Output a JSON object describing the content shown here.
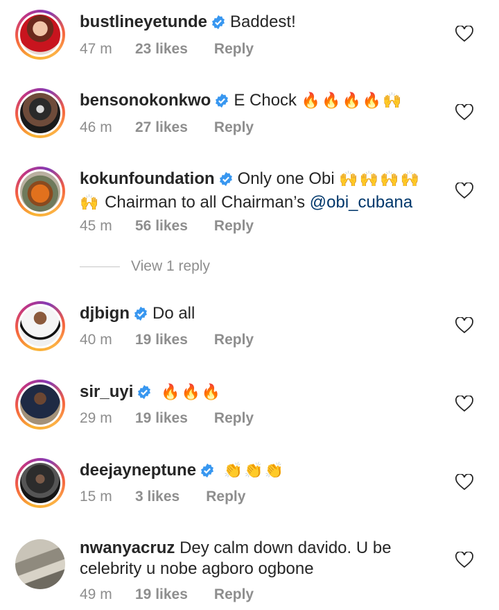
{
  "comments": [
    {
      "username": "bustlineyetunde",
      "verified": true,
      "text": "Baddest!",
      "emoji": "",
      "line2": "",
      "mention": "",
      "time": "47 m",
      "likes": "23 likes",
      "reply": "Reply"
    },
    {
      "username": "bensonokonkwo",
      "verified": true,
      "text": "E Chock",
      "emoji": "🔥🔥🔥🔥🙌",
      "line2": "",
      "mention": "",
      "time": "46 m",
      "likes": "27 likes",
      "reply": "Reply"
    },
    {
      "username": "kokunfoundation",
      "verified": true,
      "text": "Only one Obi",
      "emoji": "🙌🙌🙌🙌",
      "line2_emoji": "🙌",
      "line2": "Chairman to all Chairman’s",
      "mention": "@obi_cubana",
      "time": "45 m",
      "likes": "56 likes",
      "reply": "Reply"
    },
    {
      "username": "djbign",
      "verified": true,
      "text": "Do all",
      "emoji": "",
      "line2": "",
      "mention": "",
      "time": "40 m",
      "likes": "19 likes",
      "reply": "Reply"
    },
    {
      "username": "sir_uyi",
      "verified": true,
      "text": "",
      "emoji": "🔥🔥🔥",
      "line2": "",
      "mention": "",
      "time": "29 m",
      "likes": "19 likes",
      "reply": "Reply"
    },
    {
      "username": "deejayneptune",
      "verified": true,
      "text": "",
      "emoji": "👏👏👏",
      "line2": "",
      "mention": "",
      "time": "15 m",
      "likes": "3 likes",
      "reply": "Reply"
    },
    {
      "username": "nwanyacruz",
      "verified": false,
      "text": "Dey calm down davido. U be",
      "emoji": "",
      "line2": "celebrity u nobe agboro ogbone",
      "mention": "",
      "time": "49 m",
      "likes": "19 likes",
      "reply": "Reply"
    }
  ],
  "view_replies": "View 1 reply",
  "icons": {
    "verified": "verified-badge-icon",
    "heart": "heart-outline-icon"
  },
  "colors": {
    "verified": "#3897f0",
    "meta": "#8e8e8e",
    "mention": "#00376b"
  }
}
